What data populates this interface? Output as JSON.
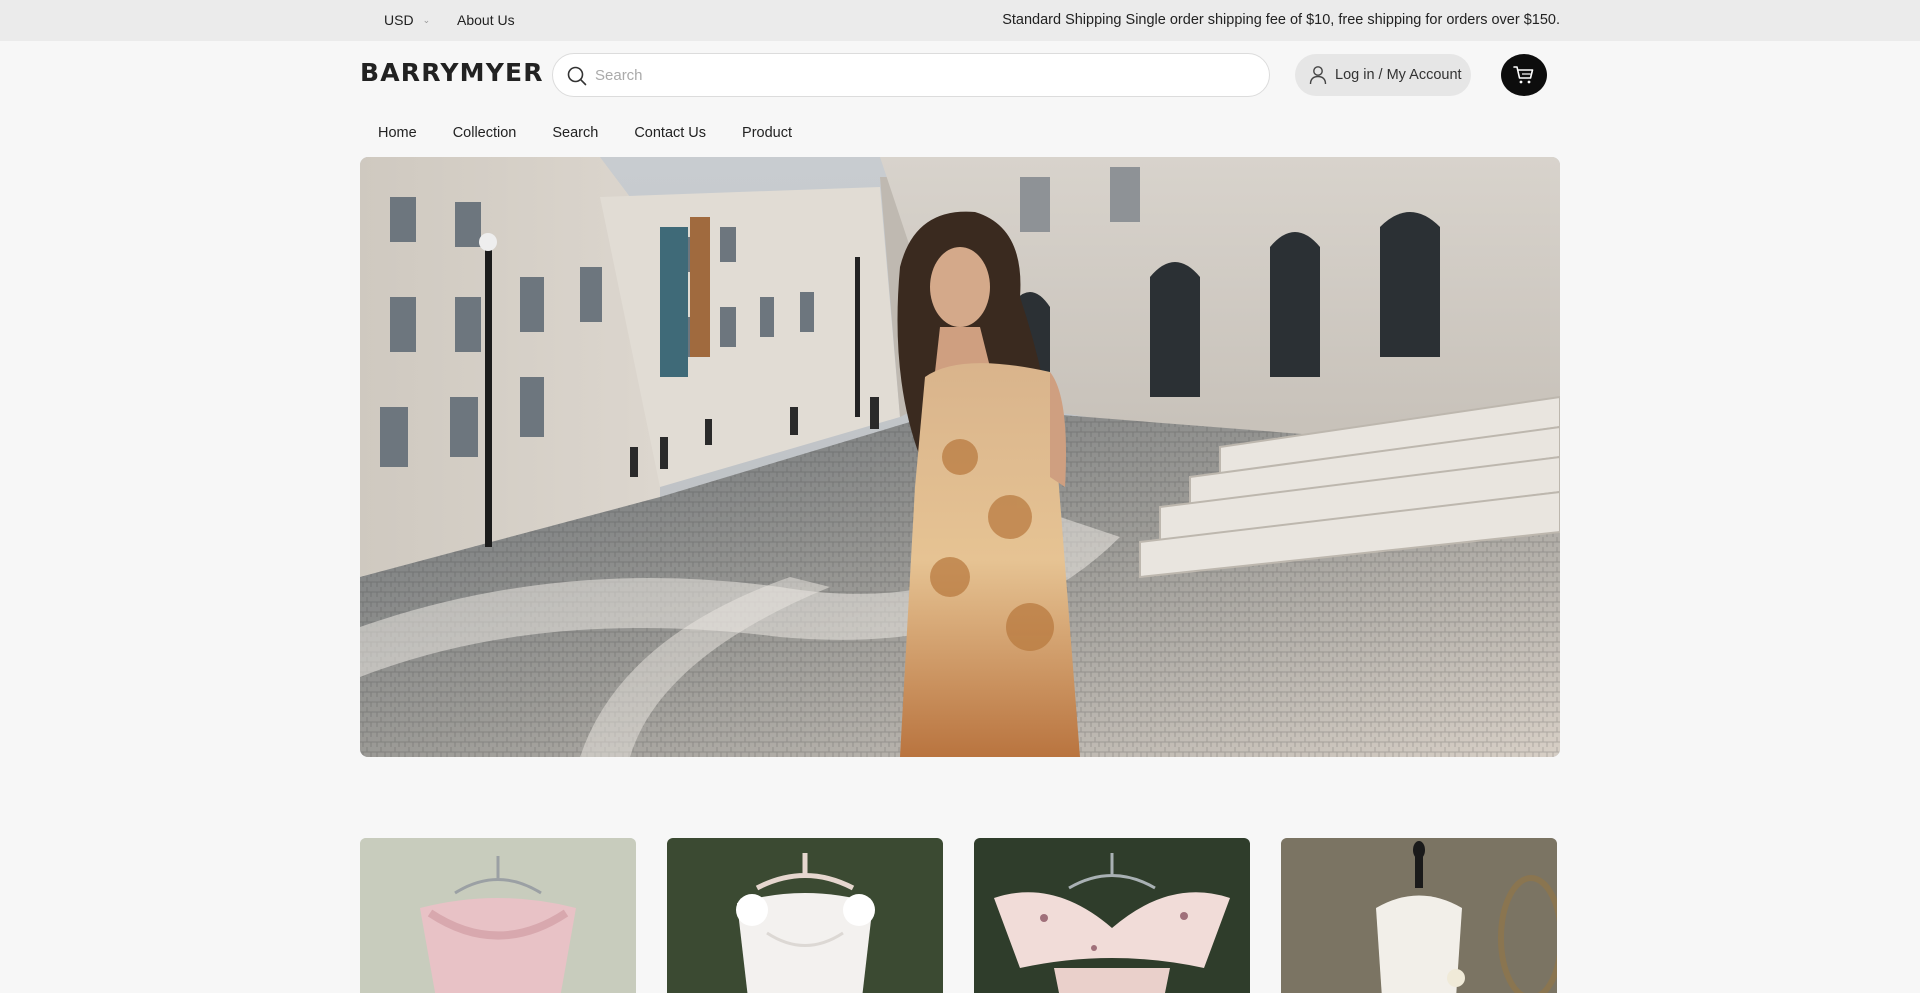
{
  "topbar": {
    "currency": "USD",
    "about": "About Us",
    "notice": "Standard Shipping Single order shipping fee of $10, free shipping for orders over $150."
  },
  "header": {
    "logo": "BARRYMYER",
    "search_placeholder": "Search",
    "account_label": "Log in / My Account"
  },
  "nav": {
    "items": [
      "Home",
      "Collection",
      "Search",
      "Contact Us",
      "Product"
    ]
  },
  "icons": {
    "search": "search-icon",
    "account": "user-icon",
    "cart": "cart-icon",
    "currency_dropdown": "chevron-down-icon"
  },
  "colors": {
    "topbar_bg": "#ebebeb",
    "page_bg": "#f7f7f7",
    "cart_bg": "#0d0d0d"
  }
}
